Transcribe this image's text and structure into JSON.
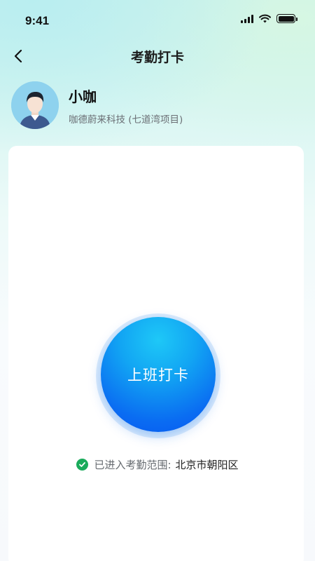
{
  "status_bar": {
    "time": "9:41",
    "icons": [
      "signal-icon",
      "wifi-icon",
      "battery-icon"
    ]
  },
  "nav": {
    "title": "考勤打卡",
    "back_icon": "chevron-left-icon"
  },
  "profile": {
    "name": "小咖",
    "company": "咖德蔚来科技 (七道湾项目)",
    "avatar": "avatar-icon"
  },
  "clock_in": {
    "button_label": "上班打卡"
  },
  "range": {
    "label": "已进入考勤范围:",
    "location": "北京市朝阳区",
    "icon": "check-circle-icon"
  },
  "colors": {
    "primary_blue": "#0a6cf2",
    "button_highlight": "#1ec8f7",
    "success_green": "#1aab5b"
  }
}
